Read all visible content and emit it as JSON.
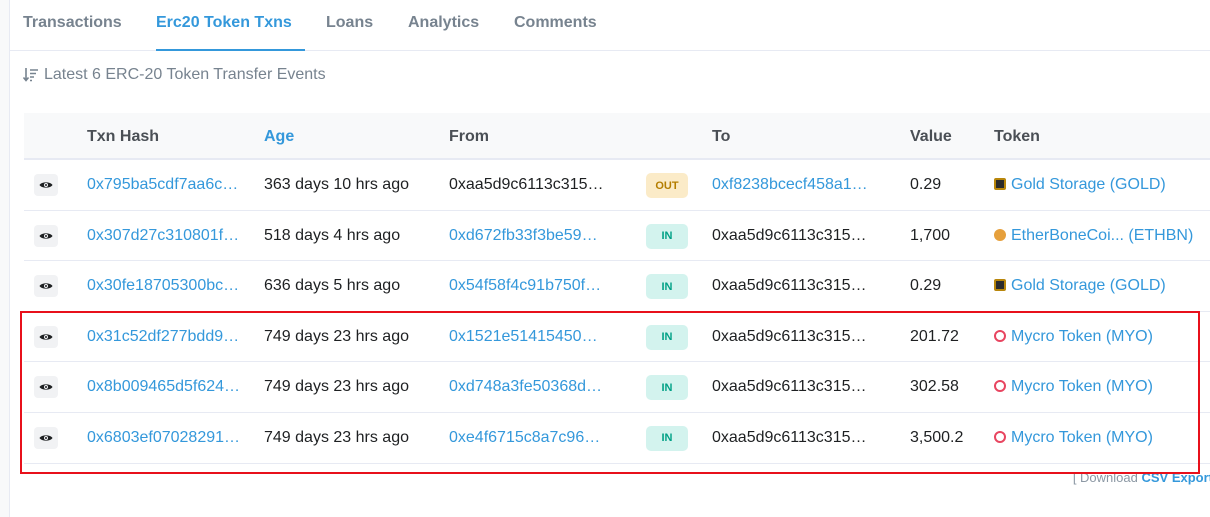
{
  "tabs": [
    {
      "label": "Transactions",
      "active": false
    },
    {
      "label": "Erc20 Token Txns",
      "active": true
    },
    {
      "label": "Loans",
      "active": false
    },
    {
      "label": "Analytics",
      "active": false
    },
    {
      "label": "Comments",
      "active": false
    }
  ],
  "summary": "Latest 6 ERC-20 Token Transfer Events",
  "headers": {
    "txn_hash": "Txn Hash",
    "age": "Age",
    "from": "From",
    "to": "To",
    "value": "Value",
    "token": "Token"
  },
  "rows": [
    {
      "hash": "0x795ba5cdf7aa6c…",
      "age": "363 days 10 hrs ago",
      "from": "0xaa5d9c6113c315…",
      "dir": "OUT",
      "to": "0xf8238bcecf458a1…",
      "value": "0.29",
      "token": "Gold Storage (GOLD)",
      "token_icon": "gold-storage-icon"
    },
    {
      "hash": "0x307d27c310801f…",
      "age": "518 days 4 hrs ago",
      "from": "0xd672fb33f3be59…",
      "dir": "IN",
      "to": "0xaa5d9c6113c315…",
      "value": "1,700",
      "token": "EtherBoneCoi... (ETHBN)",
      "token_icon": "etherbone-icon"
    },
    {
      "hash": "0x30fe18705300bc…",
      "age": "636 days 5 hrs ago",
      "from": "0x54f58f4c91b750f…",
      "dir": "IN",
      "to": "0xaa5d9c6113c315…",
      "value": "0.29",
      "token": "Gold Storage (GOLD)",
      "token_icon": "gold-storage-icon"
    },
    {
      "hash": "0x31c52df277bdd9…",
      "age": "749 days 23 hrs ago",
      "from": "0x1521e51415450…",
      "dir": "IN",
      "to": "0xaa5d9c6113c315…",
      "value": "201.72",
      "token": "Mycro Token (MYO)",
      "token_icon": "mycro-icon"
    },
    {
      "hash": "0x8b009465d5f624…",
      "age": "749 days 23 hrs ago",
      "from": "0xd748a3fe50368d…",
      "dir": "IN",
      "to": "0xaa5d9c6113c315…",
      "value": "302.58",
      "token": "Mycro Token (MYO)",
      "token_icon": "mycro-icon"
    },
    {
      "hash": "0x6803ef07028291…",
      "age": "749 days 23 hrs ago",
      "from": "0xe4f6715c8a7c96…",
      "dir": "IN",
      "to": "0xaa5d9c6113c315…",
      "value": "3,500.2",
      "token": "Mycro Token (MYO)",
      "token_icon": "mycro-icon"
    }
  ],
  "footer": {
    "prefix": "[ Download",
    "link": "CSV Export"
  },
  "colors": {
    "accent": "#3498db",
    "highlight": "#e8101b",
    "out_badge": "#fbebc8",
    "in_badge": "#d3f3ee"
  }
}
